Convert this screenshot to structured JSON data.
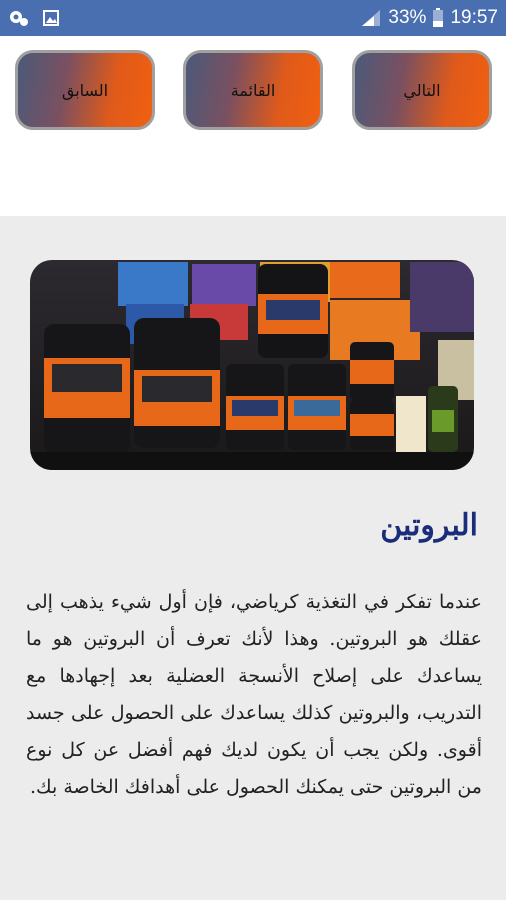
{
  "status_bar": {
    "battery_percent": "33%",
    "time": "19:57",
    "icons": [
      "notification-icon",
      "gallery-icon",
      "signal-icon",
      "battery-icon"
    ]
  },
  "nav": {
    "next_label": "التالي",
    "list_label": "القائمة",
    "previous_label": "السابق"
  },
  "article": {
    "title": "البروتين",
    "body": "عندما تفكر في التغذية كرياضي، فإن أول شيء يذهب إلى عقلك هو البروتين. وهذا لأنك تعرف أن البروتين هو ما يساعدك على إصلاح الأنسجة العضلية بعد إجهادها مع التدريب، والبروتين كذلك يساعدك على الحصول على جسد أقوى. ولكن يجب أن يكون لديك فهم أفضل عن كل نوع من البروتين حتى يمكنك الحصول على أهدافك الخاصة بك."
  },
  "colors": {
    "status_bar": "#4a6fb1",
    "title": "#1a2d7a",
    "content_bg": "#ececec",
    "button_gradient_start": "#4a5a7a",
    "button_gradient_end": "#f06010"
  }
}
